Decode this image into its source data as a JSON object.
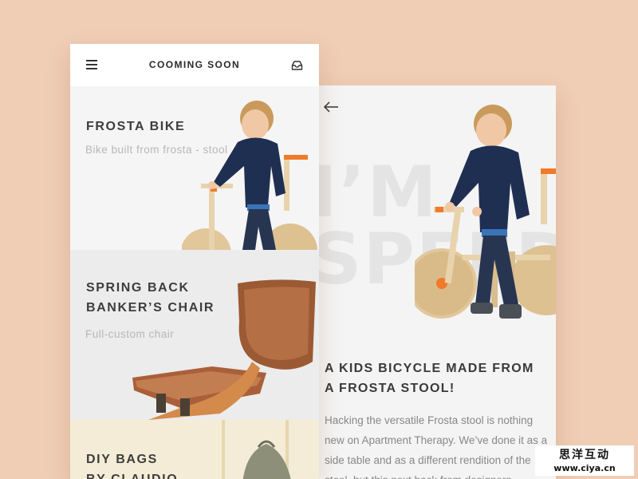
{
  "list_screen": {
    "header": {
      "title": "COOMING SOON",
      "menu_icon": "hamburger-icon",
      "inbox_icon": "inbox-icon"
    },
    "cards": [
      {
        "title": "FROSTA BIKE",
        "subtitle": "Bike built from frosta - stool"
      },
      {
        "title": "SPRING BACK\nBANKER’S CHAIR",
        "subtitle": "Full-custom chair"
      },
      {
        "title": "DIY BAGS\nBY CLAUDIO",
        "subtitle": ""
      }
    ]
  },
  "detail_screen": {
    "back_icon": "arrow-left-icon",
    "bg_text": "I’M\nSPEED",
    "headline": "A KIDS BICYCLE MADE FROM A FROSTA STOOL!",
    "body": "Hacking the versatile Frosta stool is nothing new on Apartment Therapy. We’ve done it as a side table and as a different rendition of the stool, but this next hack from designers"
  },
  "watermark": {
    "line1": "思洋互动",
    "line2": "www.ciya.cn"
  },
  "colors": {
    "background": "#f0cdb5",
    "text_dark": "#3d3d3d",
    "text_muted": "#b7b7b7",
    "accent_orange": "#f07a2a"
  }
}
